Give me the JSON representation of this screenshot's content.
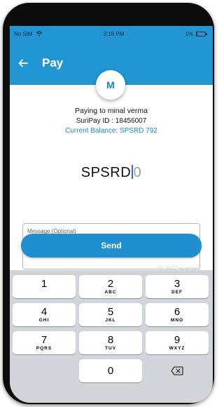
{
  "status_bar": {
    "carrier": "No SIM",
    "time": "3:16 PM",
    "battery": "1%"
  },
  "app_bar": {
    "title": "Pay",
    "back_icon": "back-arrow-icon"
  },
  "payee": {
    "avatar_initial": "M",
    "paying_to": "Paying to minal verma",
    "id": "SuriPay ID : 18456007",
    "balance": "Current Balance: SPSRD 792"
  },
  "amount": {
    "currency": "SPSRD",
    "placeholder": "0"
  },
  "message": {
    "placeholder": "Message (Optional)",
    "counter": "0/ 30 Characters"
  },
  "send_label": "Send",
  "keypad": {
    "keys": [
      {
        "digit": "1",
        "letters": ""
      },
      {
        "digit": "2",
        "letters": "ABC"
      },
      {
        "digit": "3",
        "letters": "DEF"
      },
      {
        "digit": "4",
        "letters": "GHI"
      },
      {
        "digit": "5",
        "letters": "JKL"
      },
      {
        "digit": "6",
        "letters": "MNO"
      },
      {
        "digit": "7",
        "letters": "PQRS"
      },
      {
        "digit": "8",
        "letters": "TUV"
      },
      {
        "digit": "9",
        "letters": "WXYZ"
      },
      {
        "digit": "0",
        "letters": ""
      }
    ],
    "delete_icon": "backspace-icon"
  },
  "colors": {
    "primary": "#2196d3",
    "button": "#1f8fd0",
    "balance_text": "#1e88d0",
    "keyboard_bg": "#d1d4da"
  }
}
